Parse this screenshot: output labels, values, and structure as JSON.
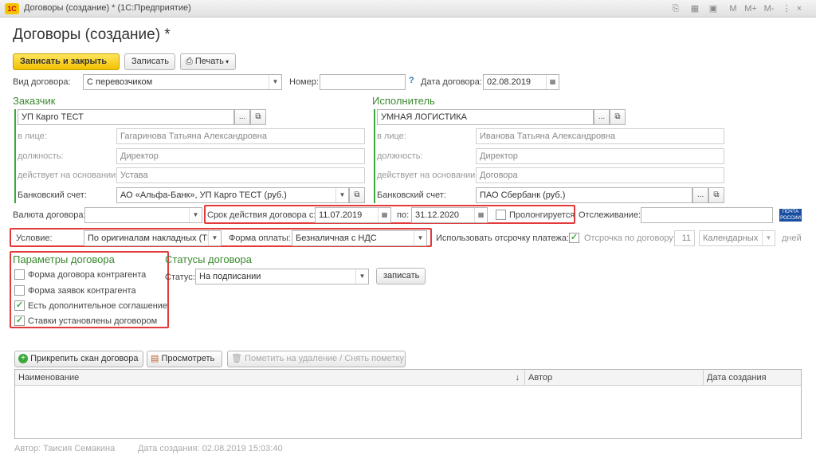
{
  "window": {
    "logo": "1С",
    "title": "Договоры (создание) * (1С:Предприятие)",
    "btn_m": "M",
    "btn_mplus": "M+",
    "btn_mminus": "M-"
  },
  "page_title": "Договоры (создание) *",
  "toolbar": {
    "save_close": "Записать и закрыть",
    "save": "Записать",
    "print": "Печать"
  },
  "header": {
    "contract_type_label": "Вид договора:",
    "contract_type_value": "С перевозчиком",
    "number_label": "Номер:",
    "number_value": "",
    "help": "?",
    "date_label": "Дата договора:",
    "date_value": "02.08.2019"
  },
  "customer": {
    "title": "Заказчик",
    "org_value": "УП Карго ТЕСТ",
    "person_label": "в лице:",
    "person_value": "Гагаринова Татьяна Александровна",
    "position_label": "должность:",
    "position_value": "Директор",
    "basis_label": "действует на основании:",
    "basis_value": "Устава",
    "bank_label": "Банковский счет:",
    "bank_value": "АО «Альфа-Банк», УП Карго ТЕСТ (руб.)"
  },
  "executor": {
    "title": "Исполнитель",
    "org_value": "УМНАЯ ЛОГИСТИКА",
    "person_label": "в лице:",
    "person_value": "Иванова Татьяна Александровна",
    "position_label": "должность:",
    "position_value": "Директор",
    "basis_label": "действует на основании:",
    "basis_value": "Договора",
    "bank_label": "Банковский счет:",
    "bank_value": "ПАО Сбербанк     (руб.)"
  },
  "validity": {
    "currency_label": "Валюта договора:",
    "currency_value": "",
    "from_label": "Срок действия договора с:",
    "from_value": "11.07.2019",
    "to_label": "по:",
    "to_value": "31.12.2020",
    "prolong_label": "Пролонгируется",
    "prolong_checked": false,
    "tracking_label": "Отслеживание:",
    "tracking_value": "",
    "post_badge": "ПОЧТА РОССИИ"
  },
  "terms": {
    "condition_label": "Условие:",
    "condition_value": "По оригиналам накладных (ТН",
    "payment_label": "Форма оплаты:",
    "payment_value": "Безналичная с НДС",
    "deferral_label": "Использовать отсрочку платежа:",
    "deferral_checked": true,
    "deferral_days_label": "Отсрочка по договору:",
    "deferral_days_value": "11",
    "deferral_type_value": "Календарных",
    "days_label": "дней"
  },
  "params": {
    "title": "Параметры договора",
    "items": [
      {
        "label": "Форма договора контрагента",
        "checked": false
      },
      {
        "label": "Форма заявок контрагента",
        "checked": false
      },
      {
        "label": "Есть дополнительное соглашение",
        "checked": true
      },
      {
        "label": "Ставки установлены договором",
        "checked": true
      }
    ]
  },
  "statuses": {
    "title": "Статусы договора",
    "status_label": "Статус:",
    "status_value": "На подписании",
    "write_button": "записать"
  },
  "attachments": {
    "attach_button": "Прикрепить скан договора",
    "view_button": "Просмотреть",
    "mark_button": "Пометить на удаление / Снять пометку",
    "columns": [
      "Наименование",
      "Автор",
      "Дата создания"
    ],
    "sort_icon": "↓"
  },
  "footer": {
    "author": "Автор: Таисия Семакина",
    "created": "Дата создания: 02.08.2019 15:03:40"
  },
  "colors": {
    "accent_green": "#3a8a2e",
    "highlight_red": "#e23a3a",
    "primary_yellow": "#f2c200"
  }
}
